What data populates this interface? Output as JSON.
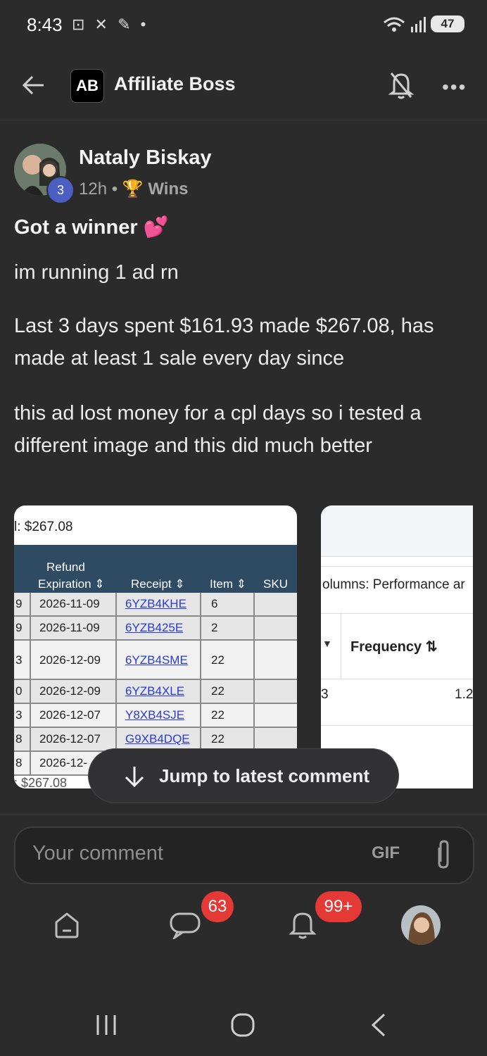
{
  "status_bar": {
    "time": "8:43",
    "battery": "47"
  },
  "header": {
    "app_name": "Affiliate Boss",
    "logo_text": "AB"
  },
  "post": {
    "author": "Nataly Biskay",
    "level": "3",
    "time_ago": "12h",
    "separator": "•",
    "category": "Wins",
    "title": "Got a winner 💕",
    "paragraphs": [
      "im running 1 ad rn",
      "Last 3 days spent $161.93 made $267.08, has made at least 1 sale every day since",
      "this ad lost money for a cpl days so i tested a different image and this did much better"
    ]
  },
  "attachment1": {
    "total_label": "l: $267.08",
    "footer_total": ": $267.08",
    "headers": {
      "refund": "Refund",
      "expiration": "Expiration",
      "receipt": "Receipt",
      "item": "Item",
      "sku": "SKU"
    },
    "rows": [
      {
        "lead": "9",
        "date": "2026-11-09",
        "receipt": "6YZB4KHE",
        "item": "6"
      },
      {
        "lead": "9",
        "date": "2026-11-09",
        "receipt": "6YZB425E",
        "item": "2"
      },
      {
        "lead": "3",
        "date": "2026-12-09",
        "receipt": "6YZB4SME",
        "item": "22"
      },
      {
        "lead": "0",
        "date": "2026-12-09",
        "receipt": "6YZB4XLE",
        "item": "22"
      },
      {
        "lead": "3",
        "date": "2026-12-07",
        "receipt": "Y8XB4SJE",
        "item": "22"
      },
      {
        "lead": "8",
        "date": "2026-12-07",
        "receipt": "G9XB4DQE",
        "item": "22"
      },
      {
        "lead": "8",
        "date": "2026-12-",
        "receipt": "",
        "item": ""
      }
    ]
  },
  "attachment2": {
    "columns_label": "olumns: Performance ar",
    "frequency_label": "Frequency ⇅",
    "value_left": "3",
    "value_right": "1.2"
  },
  "jump_button": {
    "label": "Jump to latest comment"
  },
  "comment": {
    "placeholder": "Your comment",
    "gif_label": "GIF"
  },
  "tabs": {
    "chat_badge": "63",
    "notif_badge": "99+"
  }
}
